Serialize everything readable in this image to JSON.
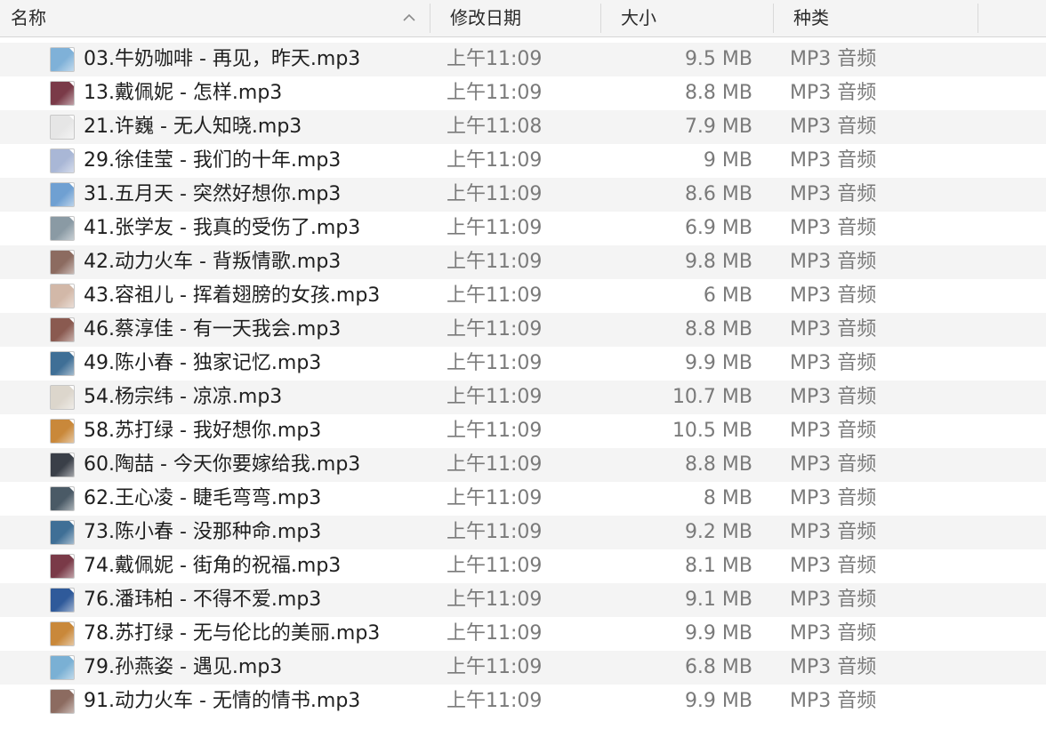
{
  "columns": {
    "name": "名称",
    "date": "修改日期",
    "size": "大小",
    "kind": "种类"
  },
  "files": [
    {
      "name": "03.牛奶咖啡 - 再见，昨天.mp3",
      "date": "上午11:09",
      "size": "9.5 MB",
      "kind": "MP3 音频",
      "color": "#7fb1d8"
    },
    {
      "name": "13.戴佩妮 -  怎样.mp3",
      "date": "上午11:09",
      "size": "8.8 MB",
      "kind": "MP3 音频",
      "color": "#7a3a48"
    },
    {
      "name": "21.许巍 - 无人知晓.mp3",
      "date": "上午11:08",
      "size": "7.9 MB",
      "kind": "MP3 音频",
      "color": "#e6e6e6"
    },
    {
      "name": "29.徐佳莹 - 我们的十年.mp3",
      "date": "上午11:09",
      "size": "9 MB",
      "kind": "MP3 音频",
      "color": "#a9b7d6"
    },
    {
      "name": "31.五月天 -  突然好想你.mp3",
      "date": "上午11:09",
      "size": "8.6 MB",
      "kind": "MP3 音频",
      "color": "#6fa0d2"
    },
    {
      "name": "41.张学友 -  我真的受伤了.mp3",
      "date": "上午11:09",
      "size": "6.9 MB",
      "kind": "MP3 音频",
      "color": "#8a9aa4"
    },
    {
      "name": "42.动力火车 -  背叛情歌.mp3",
      "date": "上午11:09",
      "size": "9.8 MB",
      "kind": "MP3 音频",
      "color": "#8c6b60"
    },
    {
      "name": "43.容祖儿 -  挥着翅膀的女孩.mp3",
      "date": "上午11:09",
      "size": "6 MB",
      "kind": "MP3 音频",
      "color": "#d2b8a8"
    },
    {
      "name": "46.蔡淳佳 -  有一天我会.mp3",
      "date": "上午11:09",
      "size": "8.8 MB",
      "kind": "MP3 音频",
      "color": "#8a5a50"
    },
    {
      "name": "49.陈小春 - 独家记忆.mp3",
      "date": "上午11:09",
      "size": "9.9 MB",
      "kind": "MP3 音频",
      "color": "#3f6f96"
    },
    {
      "name": "54.杨宗纬 - 凉凉.mp3",
      "date": "上午11:09",
      "size": "10.7 MB",
      "kind": "MP3 音频",
      "color": "#dcd6cc"
    },
    {
      "name": "58.苏打绿 - 我好想你.mp3",
      "date": "上午11:09",
      "size": "10.5 MB",
      "kind": "MP3 音频",
      "color": "#c9883a"
    },
    {
      "name": "60.陶喆 - 今天你要嫁给我.mp3",
      "date": "上午11:09",
      "size": "8.8 MB",
      "kind": "MP3 音频",
      "color": "#3a3f48"
    },
    {
      "name": "62.王心凌 -  睫毛弯弯.mp3",
      "date": "上午11:09",
      "size": "8 MB",
      "kind": "MP3 音频",
      "color": "#4a5a66"
    },
    {
      "name": "73.陈小春 - 没那种命.mp3",
      "date": "上午11:09",
      "size": "9.2 MB",
      "kind": "MP3 音频",
      "color": "#3f6f96"
    },
    {
      "name": "74.戴佩妮 -  街角的祝福.mp3",
      "date": "上午11:09",
      "size": "8.1 MB",
      "kind": "MP3 音频",
      "color": "#7a3a48"
    },
    {
      "name": "76.潘玮柏 -  不得不爱.mp3",
      "date": "上午11:09",
      "size": "9.1 MB",
      "kind": "MP3 音频",
      "color": "#2f5a9a"
    },
    {
      "name": "78.苏打绿 - 无与伦比的美丽.mp3",
      "date": "上午11:09",
      "size": "9.9 MB",
      "kind": "MP3 音频",
      "color": "#c9883a"
    },
    {
      "name": "79.孙燕姿 - 遇见.mp3",
      "date": "上午11:09",
      "size": "6.8 MB",
      "kind": "MP3 音频",
      "color": "#7ab0d4"
    },
    {
      "name": "91.动力火车 -  无情的情书.mp3",
      "date": "上午11:09",
      "size": "9.9 MB",
      "kind": "MP3 音频",
      "color": "#8c6b60"
    }
  ]
}
